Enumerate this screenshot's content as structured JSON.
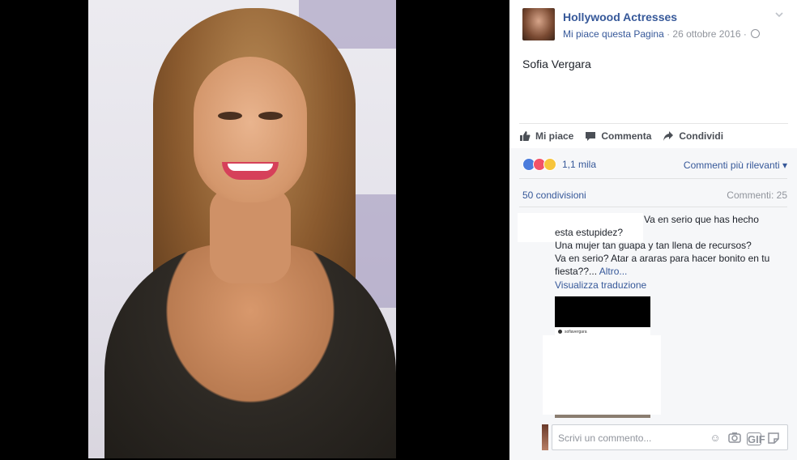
{
  "page": {
    "name": "Hollywood Actresses",
    "like_link": "Mi piace questa Pagina",
    "separator": " · ",
    "date": "26 ottobre 2016",
    "separator2": " · "
  },
  "post": {
    "text": "Sofia Vergara"
  },
  "actions": {
    "like": "Mi piace",
    "comment": "Commenta",
    "share": "Condividi"
  },
  "stats": {
    "reactions": "1,1 mila",
    "sort": "Commenti più rilevanti",
    "shares": "50 condivisioni",
    "comments": "Commenti: 25"
  },
  "comment": {
    "line1": "Va en serio que has hecho",
    "line2": "esta estupidez?",
    "line3": "Una mujer tan guapa y tan llena de recursos?",
    "line4": "Va en serio? Atar a araras para hacer bonito en tu",
    "line5": "fiesta??... ",
    "more": "Altro...",
    "translate": "Visualizza traduzione",
    "thumb_username": "sofiavergara"
  },
  "composer": {
    "placeholder": "Scrivi un commento..."
  },
  "icons": [
    "chevron-down-icon",
    "globe-icon",
    "like-icon",
    "comment-icon",
    "share-icon",
    "emoji-icon",
    "camera-icon",
    "gif-icon",
    "sticker-icon"
  ]
}
